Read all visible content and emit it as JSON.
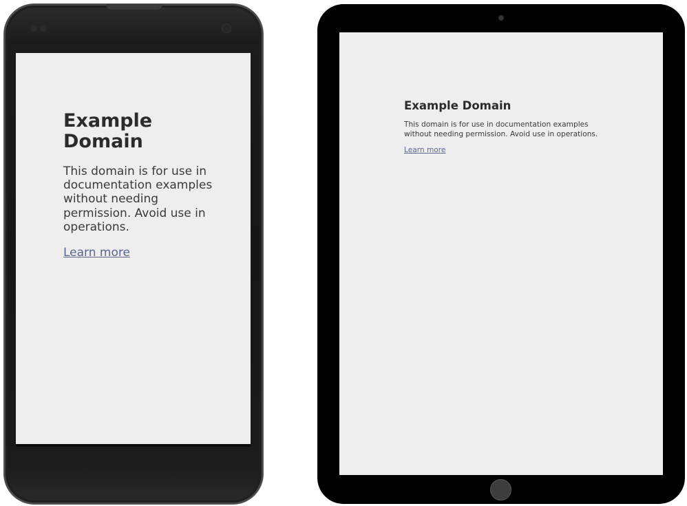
{
  "page": {
    "title": "Example Domain",
    "description": "This domain is for use in documentation examples without needing permission. Avoid use in operations.",
    "link_label": "Learn more"
  },
  "colors": {
    "page_background": "#eeeeee",
    "text": "#333333",
    "link": "#5b6690",
    "phone_body": "#1b1b1b",
    "tablet_body": "#000000"
  },
  "icons": {
    "phone_camera": "camera-icon",
    "tablet_camera": "camera-icon",
    "tablet_home_button": "home-button-icon"
  }
}
